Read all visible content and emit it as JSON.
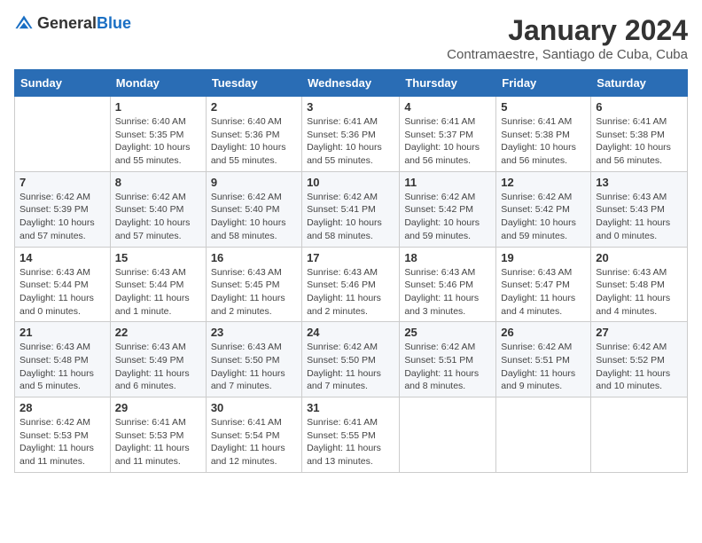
{
  "logo": {
    "general": "General",
    "blue": "Blue"
  },
  "title": "January 2024",
  "location": "Contramaestre, Santiago de Cuba, Cuba",
  "weekdays": [
    "Sunday",
    "Monday",
    "Tuesday",
    "Wednesday",
    "Thursday",
    "Friday",
    "Saturday"
  ],
  "weeks": [
    [
      {
        "day": "",
        "info": ""
      },
      {
        "day": "1",
        "info": "Sunrise: 6:40 AM\nSunset: 5:35 PM\nDaylight: 10 hours\nand 55 minutes."
      },
      {
        "day": "2",
        "info": "Sunrise: 6:40 AM\nSunset: 5:36 PM\nDaylight: 10 hours\nand 55 minutes."
      },
      {
        "day": "3",
        "info": "Sunrise: 6:41 AM\nSunset: 5:36 PM\nDaylight: 10 hours\nand 55 minutes."
      },
      {
        "day": "4",
        "info": "Sunrise: 6:41 AM\nSunset: 5:37 PM\nDaylight: 10 hours\nand 56 minutes."
      },
      {
        "day": "5",
        "info": "Sunrise: 6:41 AM\nSunset: 5:38 PM\nDaylight: 10 hours\nand 56 minutes."
      },
      {
        "day": "6",
        "info": "Sunrise: 6:41 AM\nSunset: 5:38 PM\nDaylight: 10 hours\nand 56 minutes."
      }
    ],
    [
      {
        "day": "7",
        "info": "Sunrise: 6:42 AM\nSunset: 5:39 PM\nDaylight: 10 hours\nand 57 minutes."
      },
      {
        "day": "8",
        "info": "Sunrise: 6:42 AM\nSunset: 5:40 PM\nDaylight: 10 hours\nand 57 minutes."
      },
      {
        "day": "9",
        "info": "Sunrise: 6:42 AM\nSunset: 5:40 PM\nDaylight: 10 hours\nand 58 minutes."
      },
      {
        "day": "10",
        "info": "Sunrise: 6:42 AM\nSunset: 5:41 PM\nDaylight: 10 hours\nand 58 minutes."
      },
      {
        "day": "11",
        "info": "Sunrise: 6:42 AM\nSunset: 5:42 PM\nDaylight: 10 hours\nand 59 minutes."
      },
      {
        "day": "12",
        "info": "Sunrise: 6:42 AM\nSunset: 5:42 PM\nDaylight: 10 hours\nand 59 minutes."
      },
      {
        "day": "13",
        "info": "Sunrise: 6:43 AM\nSunset: 5:43 PM\nDaylight: 11 hours\nand 0 minutes."
      }
    ],
    [
      {
        "day": "14",
        "info": "Sunrise: 6:43 AM\nSunset: 5:44 PM\nDaylight: 11 hours\nand 0 minutes."
      },
      {
        "day": "15",
        "info": "Sunrise: 6:43 AM\nSunset: 5:44 PM\nDaylight: 11 hours\nand 1 minute."
      },
      {
        "day": "16",
        "info": "Sunrise: 6:43 AM\nSunset: 5:45 PM\nDaylight: 11 hours\nand 2 minutes."
      },
      {
        "day": "17",
        "info": "Sunrise: 6:43 AM\nSunset: 5:46 PM\nDaylight: 11 hours\nand 2 minutes."
      },
      {
        "day": "18",
        "info": "Sunrise: 6:43 AM\nSunset: 5:46 PM\nDaylight: 11 hours\nand 3 minutes."
      },
      {
        "day": "19",
        "info": "Sunrise: 6:43 AM\nSunset: 5:47 PM\nDaylight: 11 hours\nand 4 minutes."
      },
      {
        "day": "20",
        "info": "Sunrise: 6:43 AM\nSunset: 5:48 PM\nDaylight: 11 hours\nand 4 minutes."
      }
    ],
    [
      {
        "day": "21",
        "info": "Sunrise: 6:43 AM\nSunset: 5:48 PM\nDaylight: 11 hours\nand 5 minutes."
      },
      {
        "day": "22",
        "info": "Sunrise: 6:43 AM\nSunset: 5:49 PM\nDaylight: 11 hours\nand 6 minutes."
      },
      {
        "day": "23",
        "info": "Sunrise: 6:43 AM\nSunset: 5:50 PM\nDaylight: 11 hours\nand 7 minutes."
      },
      {
        "day": "24",
        "info": "Sunrise: 6:42 AM\nSunset: 5:50 PM\nDaylight: 11 hours\nand 7 minutes."
      },
      {
        "day": "25",
        "info": "Sunrise: 6:42 AM\nSunset: 5:51 PM\nDaylight: 11 hours\nand 8 minutes."
      },
      {
        "day": "26",
        "info": "Sunrise: 6:42 AM\nSunset: 5:51 PM\nDaylight: 11 hours\nand 9 minutes."
      },
      {
        "day": "27",
        "info": "Sunrise: 6:42 AM\nSunset: 5:52 PM\nDaylight: 11 hours\nand 10 minutes."
      }
    ],
    [
      {
        "day": "28",
        "info": "Sunrise: 6:42 AM\nSunset: 5:53 PM\nDaylight: 11 hours\nand 11 minutes."
      },
      {
        "day": "29",
        "info": "Sunrise: 6:41 AM\nSunset: 5:53 PM\nDaylight: 11 hours\nand 11 minutes."
      },
      {
        "day": "30",
        "info": "Sunrise: 6:41 AM\nSunset: 5:54 PM\nDaylight: 11 hours\nand 12 minutes."
      },
      {
        "day": "31",
        "info": "Sunrise: 6:41 AM\nSunset: 5:55 PM\nDaylight: 11 hours\nand 13 minutes."
      },
      {
        "day": "",
        "info": ""
      },
      {
        "day": "",
        "info": ""
      },
      {
        "day": "",
        "info": ""
      }
    ]
  ]
}
